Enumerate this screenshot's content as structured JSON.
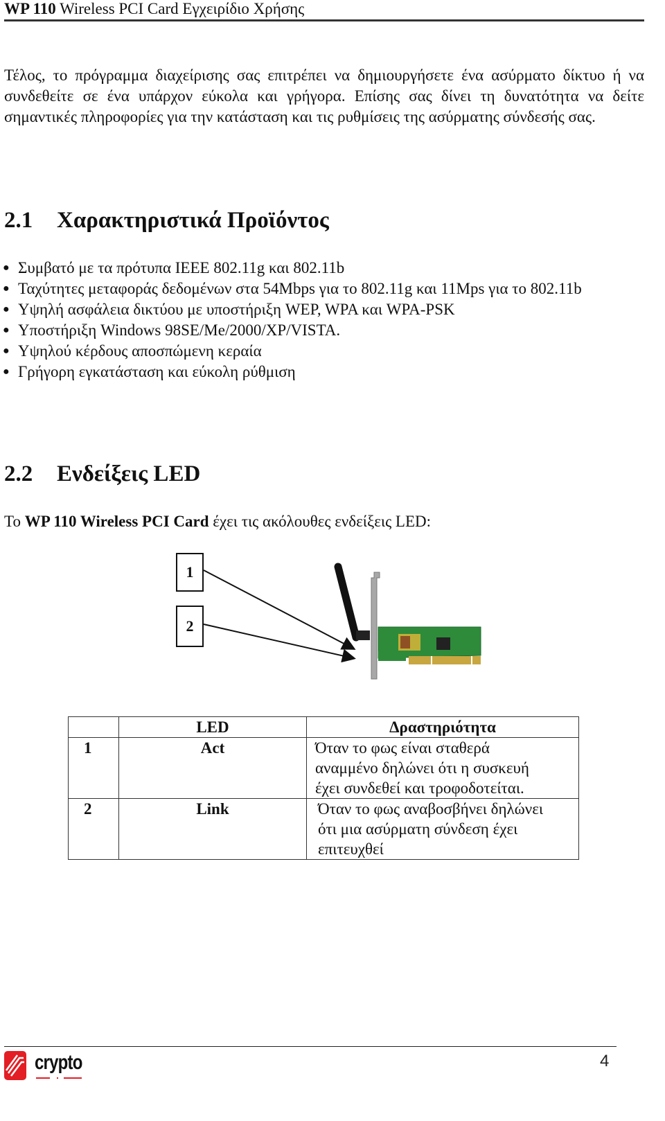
{
  "header": {
    "title_bold": "WP 110",
    "title_rest": " Wireless PCI Card Εγχειρίδιο Χρήσης"
  },
  "intro_paragraph": "Τέλος, το πρόγραμμα διαχείρισης σας επιτρέπει να δημιουργήσετε ένα ασύρματο δίκτυο ή να συνδεθείτε σε ένα υπάρχον εύκολα και γρήγορα. Επίσης σας δίνει τη δυνατότητα να δείτε σημαντικές πληροφορίες για την κατάσταση και τις ρυθμίσεις της ασύρματης σύνδεσής σας.",
  "section_features": {
    "number": "2.1",
    "title": "Χαρακτηριστικά Προϊόντος",
    "bullet_glyph": "●",
    "items": [
      "Συμβατό με τα πρότυπα IEEE 802.11g και 802.11b",
      "Ταχύτητες μεταφοράς δεδομένων στα 54Mbps για το 802.11g και 11Mps για το 802.11b",
      "Υψηλή ασφάλεια δικτύου με υποστήριξη WEP, WPA και WPA-PSK",
      "Υποστήριξη Windows 98SE/Me/2000/XP/VISTA.",
      "Υψηλού κέρδους αποσπώμενη κεραία",
      "Γρήγορη εγκατάσταση και εύκολη ρύθμιση"
    ]
  },
  "section_led": {
    "number": "2.2",
    "title": "Ενδείξεις LED",
    "intro_prefix": "Το ",
    "intro_bold": "WP 110 Wireless PCI Card",
    "intro_suffix": " έχει τις ακόλουθες ενδείξεις LED:",
    "figure_labels": [
      "1",
      "2"
    ],
    "table": {
      "headers": [
        "",
        "LED",
        "Δραστηριότητα"
      ],
      "rows": [
        {
          "num": "1",
          "led": "Act",
          "activity": "Όταν το φως είναι σταθερά αναμμένο δηλώνει ότι η συσκευή έχει συνδεθεί και τροφοδοτείται."
        },
        {
          "num": "2",
          "led": "Link",
          "activity": "Όταν το φως αναβοσβήνει δηλώνει ότι μια ασύρματη σύνδεση έχει επιτευχθεί"
        }
      ]
    }
  },
  "footer": {
    "logo_text": "crypto",
    "page_number": "4",
    "brand_color": "#e31e24"
  }
}
